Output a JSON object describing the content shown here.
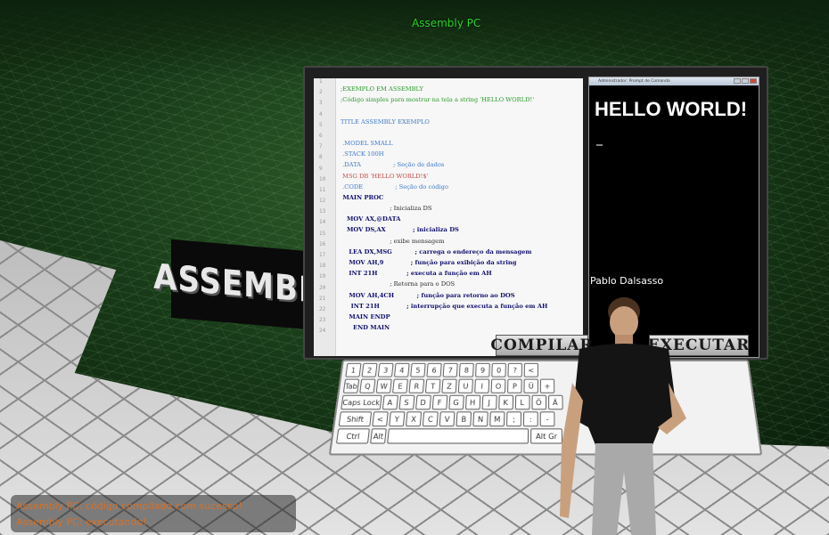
{
  "scene": {
    "floating_title": "Assembly PC",
    "sign_text": "ASSEMBLY",
    "avatar_name": "Pablo Dalsasso"
  },
  "editor": {
    "line_numbers": [
      "1",
      "2",
      "3",
      "4",
      "5",
      "6",
      "7",
      "8",
      "9",
      "10",
      "11",
      "12",
      "13",
      "14",
      "15",
      "16",
      "17",
      "18",
      "19",
      "20",
      "21",
      "22",
      "23",
      "24"
    ],
    "lines": [
      {
        "cls": "c",
        "text": ";EXEMPLO EM ASSEMBLY"
      },
      {
        "cls": "c",
        "text": ";Código simples para mostrar na tela a string 'HELLO WORLD!'"
      },
      {
        "cls": "",
        "text": ""
      },
      {
        "cls": "k",
        "text": "TITLE ASSEMBLY EXEMPLO"
      },
      {
        "cls": "",
        "text": ""
      },
      {
        "cls": "k",
        "text": " .MODEL SMALL"
      },
      {
        "cls": "k",
        "text": " .STACK 100H"
      },
      {
        "cls": "k",
        "text": " .DATA                 ; Seção de dados"
      },
      {
        "cls": "s",
        "text": " MSG DB 'HELLO WORLD!$'"
      },
      {
        "cls": "k",
        "text": " .CODE                 ; Seção do código"
      },
      {
        "cls": "b",
        "text": " MAIN PROC"
      },
      {
        "cls": "",
        "text": "                          ; Inicializa DS"
      },
      {
        "cls": "b",
        "text": "   MOV AX,@DATA"
      },
      {
        "cls": "b",
        "text": "   MOV DS,AX             ; inicializa DS"
      },
      {
        "cls": "",
        "text": "                          ; exibe mensagem"
      },
      {
        "cls": "b",
        "text": "    LEA DX,MSG           ; carrega o endereço da mensagem"
      },
      {
        "cls": "b",
        "text": "    MOV AH,9             ; função para exibição da string"
      },
      {
        "cls": "b",
        "text": "    INT 21H              ; executa a função em AH"
      },
      {
        "cls": "",
        "text": "                          ; Retorna para o DOS"
      },
      {
        "cls": "b",
        "text": "    MOV AH,4CH           ; função para retorno ao DOS"
      },
      {
        "cls": "b",
        "text": "     INT 21H             ; interrupção que executa a função em AH"
      },
      {
        "cls": "b",
        "text": "    MAIN ENDP"
      },
      {
        "cls": "b",
        "text": "      END MAIN"
      },
      {
        "cls": "",
        "text": ""
      }
    ],
    "compile_button": "COMPILAR"
  },
  "console": {
    "title": "Administrador: Prompt de Comando",
    "output": "HELLO WORLD!",
    "cursor": "_",
    "execute_button": "EXECUTAR"
  },
  "keyboard": {
    "rows": [
      [
        "1",
        "2",
        "3",
        "4",
        "5",
        "6",
        "7",
        "8",
        "9",
        "0",
        "?",
        "<"
      ],
      [
        "Tab",
        "Q",
        "W",
        "E",
        "R",
        "T",
        "Z",
        "U",
        "I",
        "O",
        "P",
        "Ü",
        "+"
      ],
      [
        "Caps Lock",
        "A",
        "S",
        "D",
        "F",
        "G",
        "H",
        "J",
        "K",
        "L",
        "Ö",
        "Ä"
      ],
      [
        "Shift",
        "<",
        "Y",
        "X",
        "C",
        "V",
        "B",
        "N",
        "M",
        ";",
        ":",
        "-"
      ],
      [
        "Ctrl",
        "Alt",
        "",
        "Alt Gr"
      ]
    ]
  },
  "chat": {
    "line1": "Assembly PC: código compilado com sucesso!",
    "line2": "Assembly PC: executando!"
  },
  "colors": {
    "title_green": "#28d428",
    "chat_orange": "#e07020"
  }
}
